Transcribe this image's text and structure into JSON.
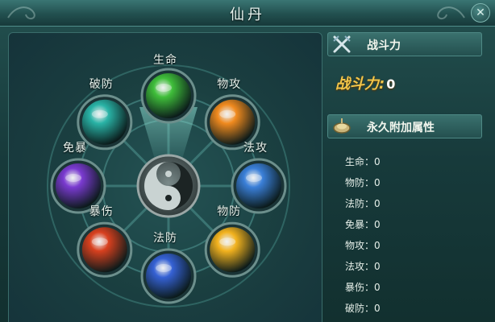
{
  "window": {
    "title": "仙丹"
  },
  "orbs": [
    {
      "label": "生命",
      "color": "#3fbe3a"
    },
    {
      "label": "物攻",
      "color": "#f08a1e"
    },
    {
      "label": "法攻",
      "color": "#3a7fd8"
    },
    {
      "label": "物防",
      "color": "#f2b21e"
    },
    {
      "label": "法防",
      "color": "#3561d4"
    },
    {
      "label": "暴伤",
      "color": "#d8401e"
    },
    {
      "label": "免暴",
      "color": "#7a3ad0"
    },
    {
      "label": "破防",
      "color": "#29b3a6"
    }
  ],
  "combat": {
    "header": "战斗力",
    "label": "战斗力:",
    "value": "0"
  },
  "attributes": {
    "header": "永久附加属性",
    "rows": [
      "生命：0",
      "物防：0",
      "法防：0",
      "免暴：0",
      "物攻：0",
      "法攻：0",
      "暴伤：0",
      "破防：0"
    ]
  }
}
